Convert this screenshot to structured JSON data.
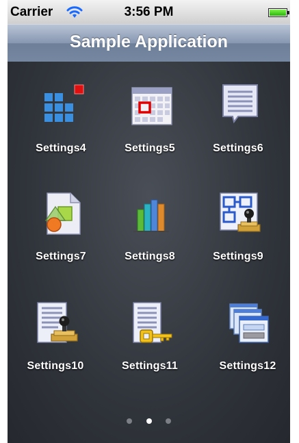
{
  "status_bar": {
    "carrier": "Carrier",
    "time": "3:56 PM"
  },
  "nav_bar": {
    "title": "Sample Application"
  },
  "grid": {
    "items": [
      {
        "label": "Settings4",
        "icon": "grid-icon"
      },
      {
        "label": "Settings5",
        "icon": "calendar-icon"
      },
      {
        "label": "Settings6",
        "icon": "note-bubble-icon"
      },
      {
        "label": "Settings7",
        "icon": "shapes-document-icon"
      },
      {
        "label": "Settings8",
        "icon": "bar-chart-icon"
      },
      {
        "label": "Settings9",
        "icon": "diagram-stamp-icon"
      },
      {
        "label": "Settings10",
        "icon": "document-stamp-icon"
      },
      {
        "label": "Settings11",
        "icon": "document-key-icon"
      },
      {
        "label": "Settings12",
        "icon": "windows-icon"
      }
    ]
  },
  "pager": {
    "pages": 3,
    "current_page": 2
  },
  "colors": {
    "background": "#2c3036",
    "nav_bar": "#7f8fab",
    "status_bar": "#e0e0e0",
    "label": "#ffffff"
  }
}
